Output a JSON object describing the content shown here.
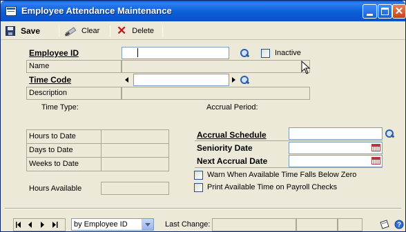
{
  "window": {
    "title": "Employee Attendance Maintenance"
  },
  "toolbar": {
    "save_label": "Save",
    "clear_label": "Clear",
    "delete_label": "Delete"
  },
  "form": {
    "employee_id_label": "Employee ID",
    "employee_id_value": "",
    "inactive_label": "Inactive",
    "name_label": "Name",
    "time_code_label": "Time Code",
    "time_code_value": "",
    "description_label": "Description",
    "time_type_label": "Time Type:",
    "accrual_period_label": "Accrual Period:",
    "hours_to_date_label": "Hours to Date",
    "days_to_date_label": "Days to Date",
    "weeks_to_date_label": "Weeks to Date",
    "hours_available_label": "Hours Available",
    "accrual_schedule_label": "Accrual Schedule",
    "seniority_date_label": "Seniority Date",
    "next_accrual_date_label": "Next Accrual Date",
    "warn_label": "Warn When Available Time Falls Below Zero",
    "print_label": "Print Available Time on Payroll Checks"
  },
  "footer": {
    "sort_by_value": "by Employee ID",
    "last_change_label": "Last Change:"
  },
  "icons": {
    "window": "window-app-icon",
    "save": "save-icon",
    "clear": "clear-eraser-icon",
    "delete": "delete-x-icon",
    "lookup": "magnifier-lookup-icon",
    "calendar": "calendar-icon",
    "note": "note-icon",
    "help": "help-icon"
  },
  "colors": {
    "titlebar": "#0a5ddc",
    "background": "#ece9d8",
    "delete": "#c01818"
  }
}
